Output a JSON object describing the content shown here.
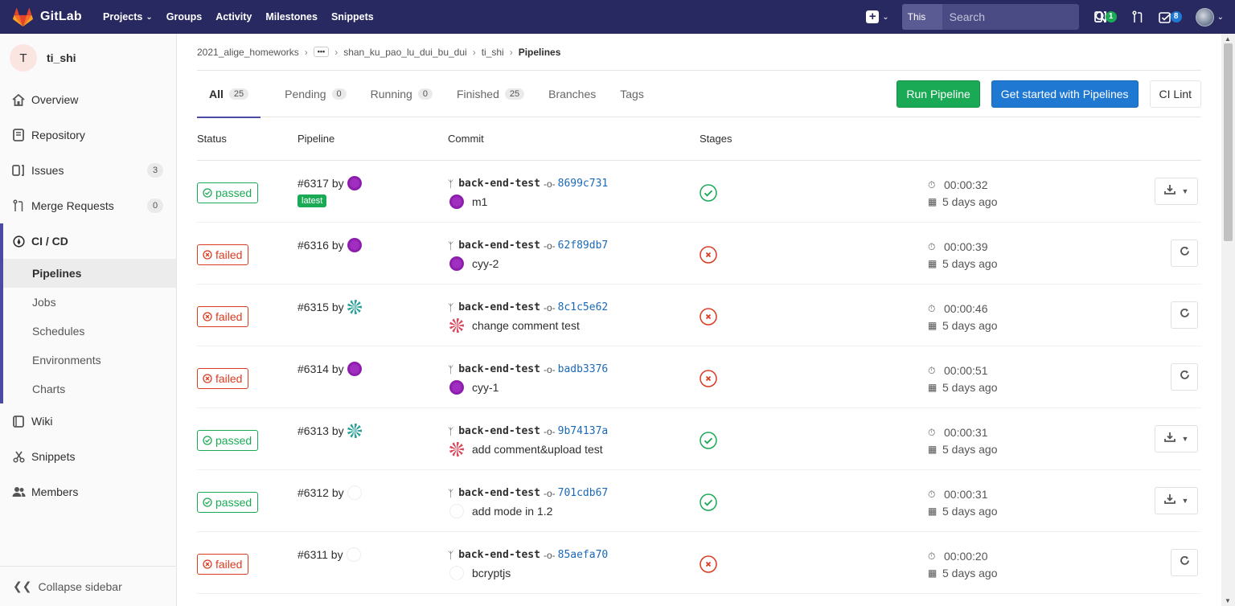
{
  "app": {
    "name": "GitLab"
  },
  "nav": {
    "links": [
      {
        "label": "Projects",
        "dropdown": true
      },
      {
        "label": "Groups"
      },
      {
        "label": "Activity"
      },
      {
        "label": "Milestones"
      },
      {
        "label": "Snippets"
      }
    ],
    "search_scope": "This project",
    "search_placeholder": "Search",
    "issues_badge": "1",
    "todos_badge": "8"
  },
  "sidebar": {
    "project_initial": "T",
    "project_name": "ti_shi",
    "items": [
      {
        "label": "Overview",
        "icon": "home-icon"
      },
      {
        "label": "Repository",
        "icon": "repository-icon"
      },
      {
        "label": "Issues",
        "icon": "issues-icon",
        "count": "3"
      },
      {
        "label": "Merge Requests",
        "icon": "merge-request-icon",
        "count": "0"
      }
    ],
    "cicd": {
      "label": "CI / CD",
      "sub_items": [
        "Pipelines",
        "Jobs",
        "Schedules",
        "Environments",
        "Charts"
      ],
      "active": "Pipelines"
    },
    "items_after": [
      {
        "label": "Wiki",
        "icon": "wiki-icon"
      },
      {
        "label": "Snippets",
        "icon": "snippets-icon"
      },
      {
        "label": "Members",
        "icon": "members-icon"
      }
    ],
    "collapse_label": "Collapse sidebar"
  },
  "breadcrumb": {
    "group": "2021_alige_homeworks",
    "ellipsis": "•••",
    "subgroup": "shan_ku_pao_lu_dui_bu_dui",
    "project": "ti_shi",
    "current": "Pipelines"
  },
  "tabs": [
    {
      "label": "All",
      "count": "25",
      "active": true
    },
    {
      "label": "Pending",
      "count": "0"
    },
    {
      "label": "Running",
      "count": "0"
    },
    {
      "label": "Finished",
      "count": "25"
    },
    {
      "label": "Branches"
    },
    {
      "label": "Tags"
    }
  ],
  "buttons": {
    "run_pipeline": "Run Pipeline",
    "get_started": "Get started with Pipelines",
    "ci_lint": "CI Lint"
  },
  "table": {
    "headers": {
      "status": "Status",
      "pipeline": "Pipeline",
      "commit": "Commit",
      "stages": "Stages"
    },
    "rows": [
      {
        "status": "passed",
        "pipeline": "#6317 by",
        "avatar": "purple",
        "latest": "latest",
        "branch": "back-end-test",
        "sha": "8699c731",
        "commit_avatar": "purple",
        "message": "m1",
        "stage": "passed",
        "duration": "00:00:32",
        "finished": "5 days ago",
        "action": "download"
      },
      {
        "status": "failed",
        "pipeline": "#6316 by",
        "avatar": "purple",
        "branch": "back-end-test",
        "sha": "62f89db7",
        "commit_avatar": "purple",
        "message": "cyy-2",
        "stage": "failed",
        "duration": "00:00:39",
        "finished": "5 days ago",
        "action": "retry"
      },
      {
        "status": "failed",
        "pipeline": "#6315 by",
        "avatar": "teal",
        "branch": "back-end-test",
        "sha": "8c1c5e62",
        "commit_avatar": "pink",
        "message": "change comment test",
        "stage": "failed",
        "duration": "00:00:46",
        "finished": "5 days ago",
        "action": "retry"
      },
      {
        "status": "failed",
        "pipeline": "#6314 by",
        "avatar": "purple",
        "branch": "back-end-test",
        "sha": "badb3376",
        "commit_avatar": "purple",
        "message": "cyy-1",
        "stage": "failed",
        "duration": "00:00:51",
        "finished": "5 days ago",
        "action": "retry"
      },
      {
        "status": "passed",
        "pipeline": "#6313 by",
        "avatar": "teal",
        "branch": "back-end-test",
        "sha": "9b74137a",
        "commit_avatar": "pink",
        "message": "add comment&upload test",
        "stage": "passed",
        "duration": "00:00:31",
        "finished": "5 days ago",
        "action": "download"
      },
      {
        "status": "passed",
        "pipeline": "#6312 by",
        "avatar": "blank",
        "branch": "back-end-test",
        "sha": "701cdb67",
        "commit_avatar": "blank",
        "message": "add mode in 1.2",
        "stage": "passed",
        "duration": "00:00:31",
        "finished": "5 days ago",
        "action": "download"
      },
      {
        "status": "failed",
        "pipeline": "#6311 by",
        "avatar": "blank",
        "branch": "back-end-test",
        "sha": "85aefa70",
        "commit_avatar": "blank",
        "message": "bcryptjs",
        "stage": "failed",
        "duration": "00:00:20",
        "finished": "5 days ago",
        "action": "retry"
      }
    ]
  },
  "colors": {
    "navbar": "#292961",
    "passed": "#1aaa55",
    "failed": "#db3b21",
    "link": "#1b69b6",
    "accent": "#4b4ba3"
  }
}
